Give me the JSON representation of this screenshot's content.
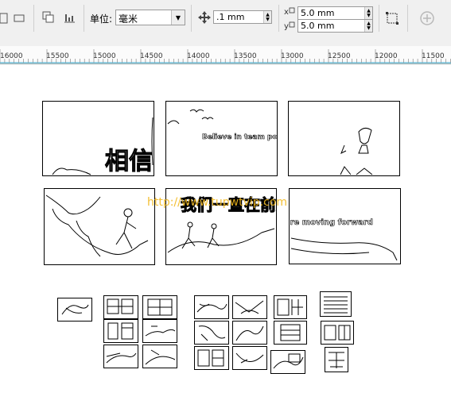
{
  "toolbar": {
    "unit_label": "单位:",
    "unit_value": "毫米",
    "nudge_value": ".1 mm",
    "dup_x": "5.0 mm",
    "dup_y": "5.0 mm"
  },
  "ruler": {
    "labels": [
      "16000",
      "15500",
      "15000",
      "14500",
      "14000",
      "13500",
      "13000",
      "12500",
      "12000",
      "11500"
    ]
  },
  "artwork": {
    "title_top": "相信 团队的力量",
    "tagline_top": "Believe in team power",
    "title_bottom": "我们一直在前进",
    "tagline_bottom": "We're moving forward"
  },
  "watermark": "http://www.tupwtvip.com"
}
